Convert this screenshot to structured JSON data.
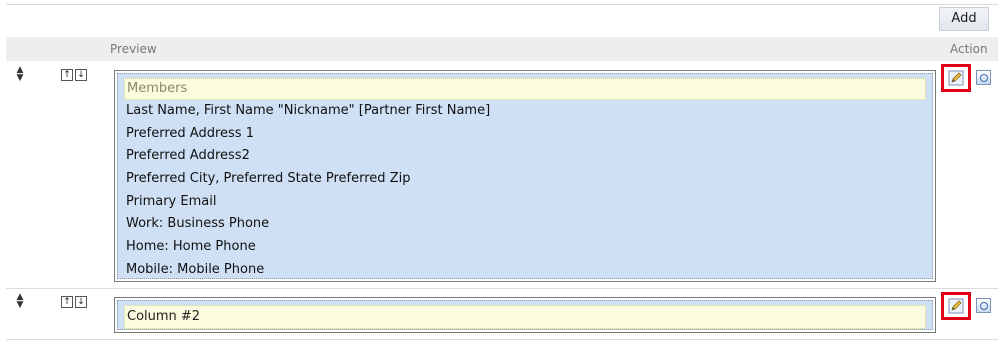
{
  "toolbar": {
    "add_label": "Add"
  },
  "table": {
    "header": {
      "preview": "Preview",
      "action": "Action"
    },
    "rows": [
      {
        "title": "Members",
        "lines": [
          "Last Name, First Name \"Nickname\" [Partner First Name]",
          "Preferred Address 1",
          "Preferred Address2",
          "Preferred City, Preferred State Preferred Zip",
          "Primary Email",
          "Work: Business Phone",
          "Home: Home Phone",
          "Mobile: Mobile Phone"
        ]
      },
      {
        "title": "Column #2",
        "lines": []
      }
    ]
  },
  "icons": {
    "drag": "drag-handle-icon",
    "move_up": "move-up-icon",
    "move_down": "move-down-icon",
    "edit": "edit-pencil-icon",
    "copy": "copy-icon"
  },
  "colors": {
    "highlight_border": "#e0001a",
    "panel_bg": "#cfe0f5",
    "title_bg": "#fbfbdf"
  }
}
